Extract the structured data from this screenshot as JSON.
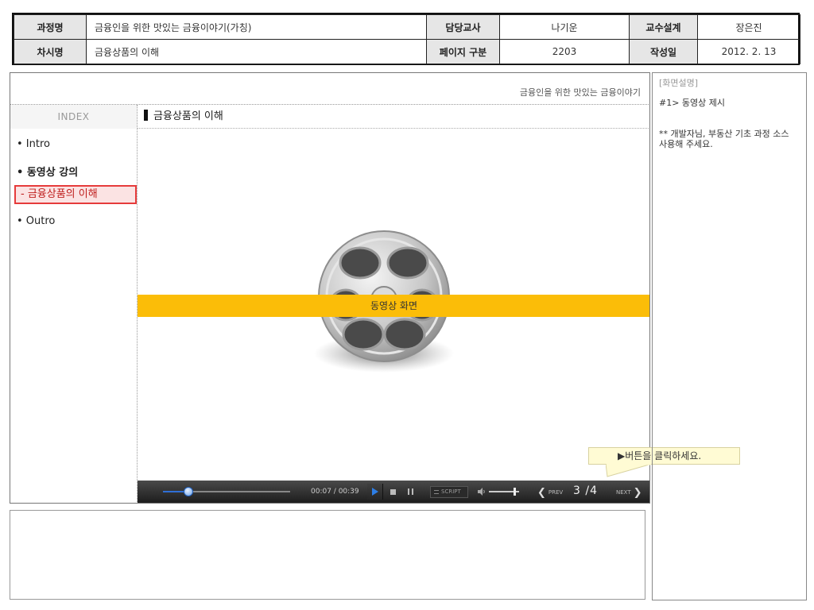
{
  "header": {
    "course_label": "과정명",
    "course_value": "금융인을 위한 맛있는 금융이야기(가칭)",
    "teacher_label": "담당교사",
    "teacher_value": "나기운",
    "design_label": "교수설계",
    "design_value": "장은진",
    "session_label": "차시명",
    "session_value": "금융상품의 이해",
    "page_label": "페이지 구분",
    "page_value": "2203",
    "date_label": "작성일",
    "date_value": "2012. 2. 13"
  },
  "screen": {
    "site_title": "금융인을 위한 맛있는 금융이야기",
    "sidebar": {
      "index_label": "INDEX",
      "items": [
        {
          "label": "• Intro"
        },
        {
          "label": "• 동영상 강의"
        },
        {
          "label": "- 금융상품의 이해"
        },
        {
          "label": "• Outro"
        }
      ]
    },
    "section_title": "금융상품의 이해",
    "video_label": "동영상 화면",
    "player": {
      "time": "00:07 / 00:39",
      "progress": 0.2,
      "volume": 0.85,
      "script_label": "SCRIPT",
      "prev_label": "PREV",
      "next_label": "NEXT",
      "page_indicator": "3 /4"
    }
  },
  "callout": "▶버튼을 클릭하세요.",
  "description": {
    "title": "[화면설명]",
    "line1": "#1> 동영상 제시",
    "note": "** 개발자님, 부동산 기초 과정 소스 사용해 주세요."
  },
  "colors": {
    "video_band": "#fbbd08",
    "active_menu_border": "#e63b3b",
    "seek_fill": "#2f6fd6",
    "callout_bg": "#fffbd4"
  }
}
